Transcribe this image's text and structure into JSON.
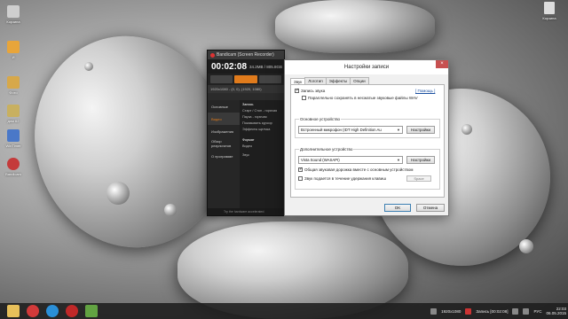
{
  "desktop": {
    "icons": [
      {
        "label": "Корзина",
        "color": "#cfcfcf"
      },
      {
        "label": "И",
        "color": "#e8a53a"
      },
      {
        "label": "Фото",
        "color": "#d7a84a"
      },
      {
        "label": "дом 62",
        "color": "#c8b060"
      },
      {
        "label": "WinTimer",
        "color": "#4a78c8"
      },
      {
        "label": "Bandicam",
        "color": "#c43b3b"
      }
    ],
    "recycle_label": "Корзина"
  },
  "bandicam": {
    "title": "Bandicam (Screen Recorder)",
    "timer": "00:02:08",
    "size": "34.2MB / 805.8GB",
    "resolution": "1920x1080 - (0, 0), (1920, 1080)",
    "sidebar": [
      "Основные",
      "Видео",
      "Изображения",
      "Обзор результатов",
      "О программе"
    ],
    "main_section": "Запись",
    "main_items": [
      "Старт / Стоп - горячая",
      "Пауза - горячая",
      "Показывать курсор",
      "Эффекты щелчка"
    ],
    "format_label": "Формат",
    "video_label": "Видео",
    "audio_label": "Звук",
    "footer": "Try the hardware accelerated"
  },
  "dialog": {
    "title": "Настройки записи",
    "close": "×",
    "tabs": [
      "Звук",
      "Логотип",
      "Эффекты",
      "Опции"
    ],
    "record_sound": "Запись звука",
    "help": "[ Помощь ]",
    "parallel_wav": "Параллельно сохранять в несжатые звуковые файлы WAV",
    "primary_group": "Основное устройство",
    "primary_device": "Встроенный микрофон (IDT High Definition Au",
    "secondary_group": "Дополнительное устройство",
    "secondary_device": "Vista Sound (WASAPI)",
    "settings_btn": "Настройки",
    "mix_track": "Общая звуковая дорожка вместе с основным устройством",
    "hotkey_label": "Звук подается в течение удержания клавиш",
    "hotkey_value": "Space",
    "ok": "OK",
    "cancel": "Отмена"
  },
  "taskbar": {
    "apps": [
      {
        "name": "explorer",
        "color": "#e8c05a"
      },
      {
        "name": "opera",
        "color": "#d23a3a"
      },
      {
        "name": "skype",
        "color": "#2a8fd8"
      },
      {
        "name": "bandicam",
        "color": "#c02828"
      },
      {
        "name": "green-app",
        "color": "#62a342"
      }
    ],
    "tray_resolution": "1920x1080",
    "tray_recording": "Запись [00:02:08]",
    "lang": "РУС",
    "time": "22:03",
    "date": "06.05.2015"
  }
}
